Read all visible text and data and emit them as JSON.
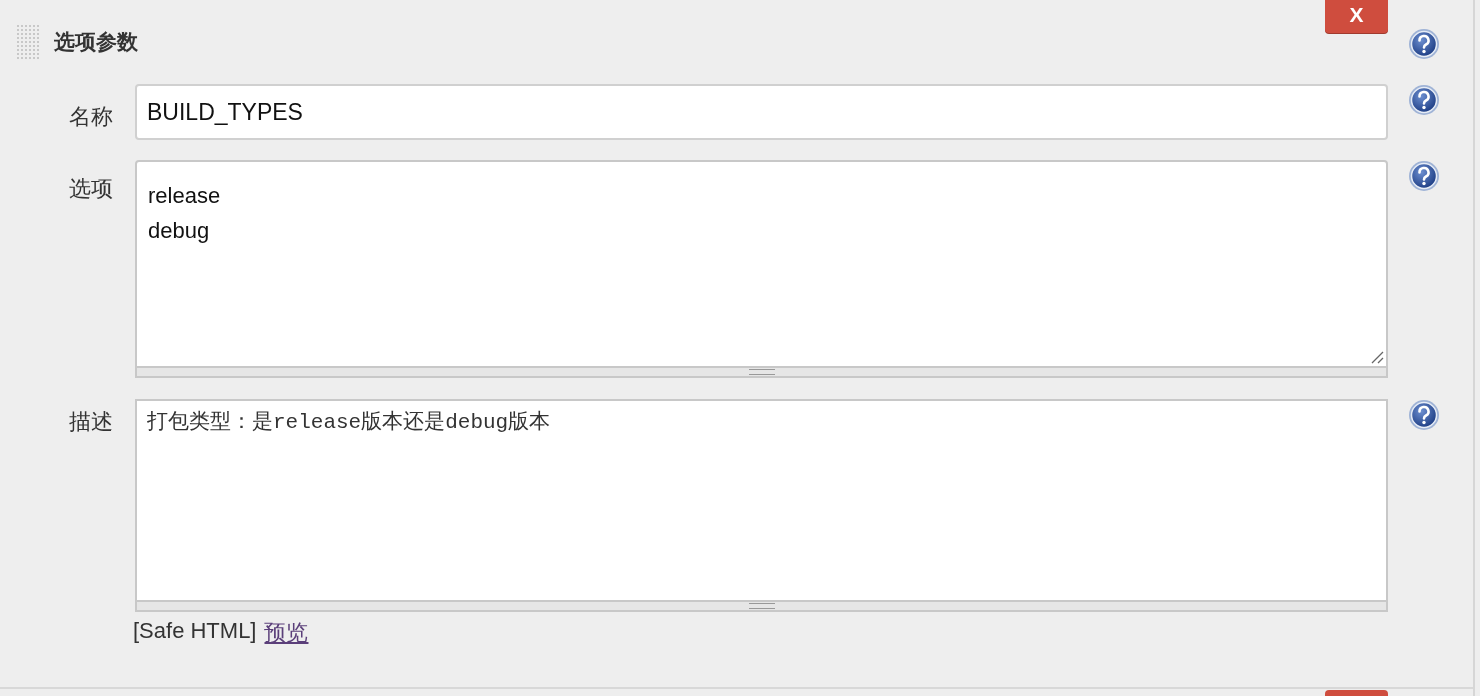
{
  "section": {
    "title": "选项参数",
    "delete_button": "X"
  },
  "fields": [
    {
      "kind": "input",
      "label": "名称",
      "value": "BUILD_TYPES"
    },
    {
      "kind": "textarea",
      "label": "选项",
      "value": "release\ndebug"
    },
    {
      "kind": "richtext",
      "label": "描述",
      "value": "打包类型：是release版本还是debug版本"
    }
  ],
  "markup_note": {
    "format": "[Safe HTML]",
    "preview_link": "预览"
  }
}
